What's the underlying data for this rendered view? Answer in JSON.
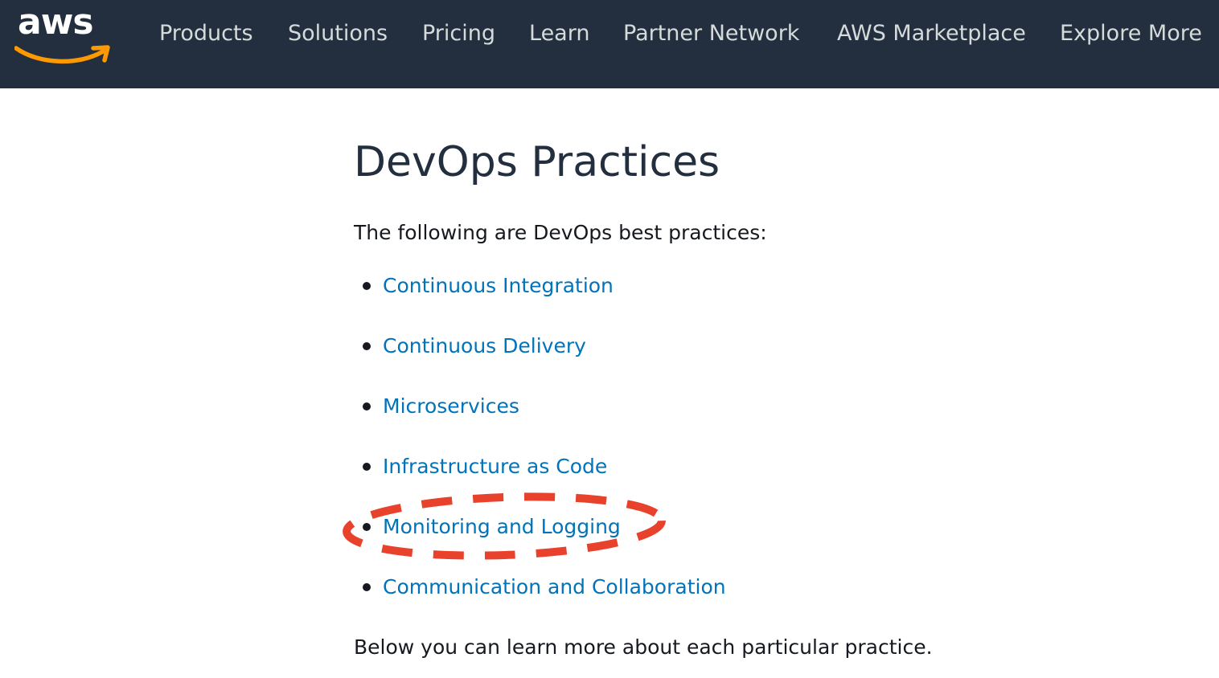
{
  "header": {
    "logo_text": "aws",
    "nav": [
      {
        "label": "Products"
      },
      {
        "label": "Solutions"
      },
      {
        "label": "Pricing"
      },
      {
        "label": "Learn"
      },
      {
        "label": "Partner Network"
      },
      {
        "label": "AWS Marketplace"
      },
      {
        "label": "Explore More"
      }
    ]
  },
  "main": {
    "title": "DevOps Practices",
    "intro": "The following are DevOps best practices:",
    "practices": [
      {
        "label": "Continuous Integration"
      },
      {
        "label": "Continuous Delivery"
      },
      {
        "label": "Microservices"
      },
      {
        "label": "Infrastructure as Code"
      },
      {
        "label": "Monitoring and Logging"
      },
      {
        "label": "Communication and Collaboration"
      }
    ],
    "outro": "Below you can learn more about each particular practice."
  },
  "annotation": {
    "target": "Monitoring and Logging",
    "style": "dashed-ellipse",
    "color": "#e8412c"
  },
  "colors": {
    "header_bg": "#232f3e",
    "link": "#0073bb",
    "logo_smile": "#ff9900"
  }
}
